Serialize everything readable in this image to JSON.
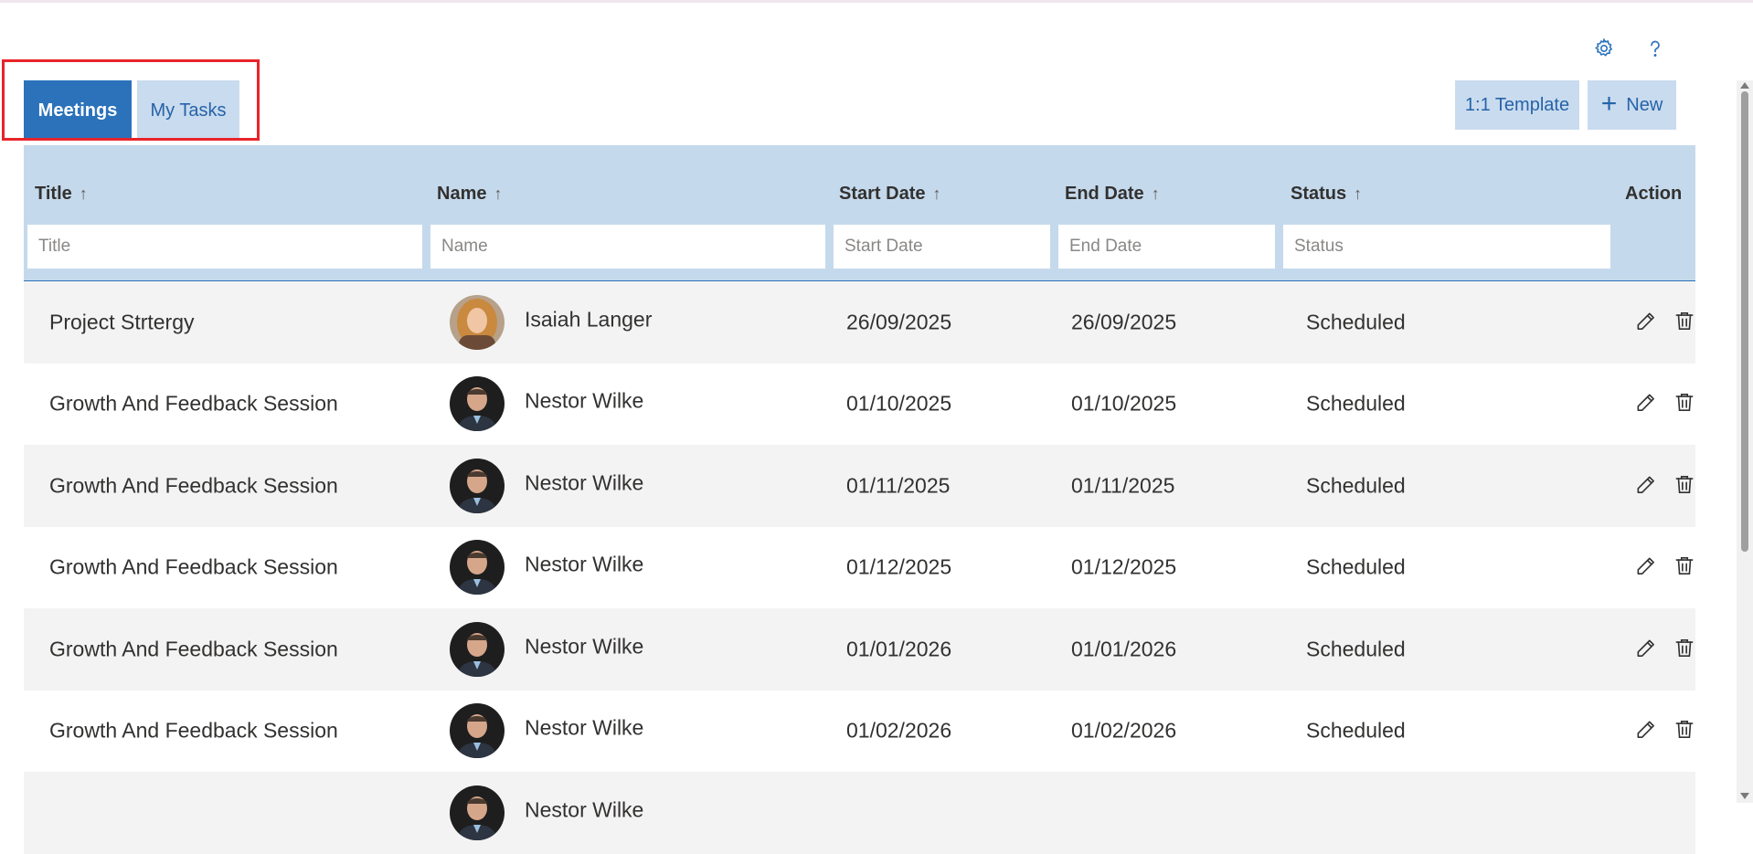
{
  "tabs": [
    {
      "label": "Meetings",
      "active": true
    },
    {
      "label": "My Tasks",
      "active": false
    }
  ],
  "toolbar": {
    "template_label": "1:1 Template",
    "new_label": "New",
    "icons": [
      "settings-icon",
      "help-icon"
    ]
  },
  "table": {
    "columns": [
      {
        "label": "Title",
        "sort": "↑",
        "placeholder": "Title"
      },
      {
        "label": "Name",
        "sort": "↑",
        "placeholder": "Name"
      },
      {
        "label": "Start Date",
        "sort": "↑",
        "placeholder": "Start Date"
      },
      {
        "label": "End Date",
        "sort": "↑",
        "placeholder": "End Date"
      },
      {
        "label": "Status",
        "sort": "↑",
        "placeholder": "Status"
      },
      {
        "label": "Action"
      }
    ],
    "rows": [
      {
        "title": "Project Strtergy",
        "name": "Isaiah Langer",
        "start": "26/09/2025",
        "end": "26/09/2025",
        "status": "Scheduled"
      },
      {
        "title": "Growth And Feedback Session",
        "name": "Nestor Wilke",
        "start": "01/10/2025",
        "end": "01/10/2025",
        "status": "Scheduled"
      },
      {
        "title": "Growth And Feedback Session",
        "name": "Nestor Wilke",
        "start": "01/11/2025",
        "end": "01/11/2025",
        "status": "Scheduled"
      },
      {
        "title": "Growth And Feedback Session",
        "name": "Nestor Wilke",
        "start": "01/12/2025",
        "end": "01/12/2025",
        "status": "Scheduled"
      },
      {
        "title": "Growth And Feedback Session",
        "name": "Nestor Wilke",
        "start": "01/01/2026",
        "end": "01/01/2026",
        "status": "Scheduled"
      },
      {
        "title": "Growth And Feedback Session",
        "name": "Nestor Wilke",
        "start": "01/02/2026",
        "end": "01/02/2026",
        "status": "Scheduled"
      },
      {
        "title": "",
        "name": "Nestor Wilke",
        "start": "",
        "end": "",
        "status": ""
      }
    ]
  },
  "colors": {
    "accent": "#2b72bb",
    "accent_light": "#c9dbee",
    "header_bg": "#c5d9ec",
    "row_alt": "#f3f3f3",
    "highlight": "#e8242a"
  }
}
